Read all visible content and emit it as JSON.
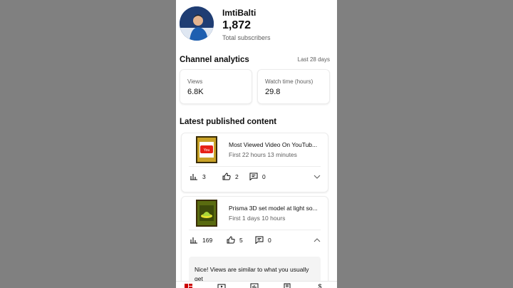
{
  "channel": {
    "name": "ImtiBalti",
    "subscribers": "1,872",
    "subscribers_label": "Total subscribers"
  },
  "analytics": {
    "title": "Channel analytics",
    "period": "Last 28 days",
    "views_label": "Views",
    "views_value": "6.8K",
    "watch_label": "Watch time (hours)",
    "watch_value": "29.8"
  },
  "latest": {
    "title": "Latest published content",
    "items": [
      {
        "title": "Most Viewed Video On YouTub...",
        "subtitle": "First 22 hours 13 minutes",
        "views": "3",
        "likes": "2",
        "comments": "0",
        "expanded": false
      },
      {
        "title": "Prisma 3D set model at light so...",
        "subtitle": "First 1 days 10 hours",
        "views": "169",
        "likes": "5",
        "comments": "0",
        "expanded": true,
        "insight": "Nice! Views are similar to what you usually get"
      }
    ]
  },
  "bottom_nav": [
    "dashboard-icon",
    "content-icon",
    "analytics-icon",
    "comments-icon",
    "earn-icon"
  ],
  "colors": {
    "accent": "#cc0000",
    "muted": "#606060",
    "background": "#ffffff"
  }
}
